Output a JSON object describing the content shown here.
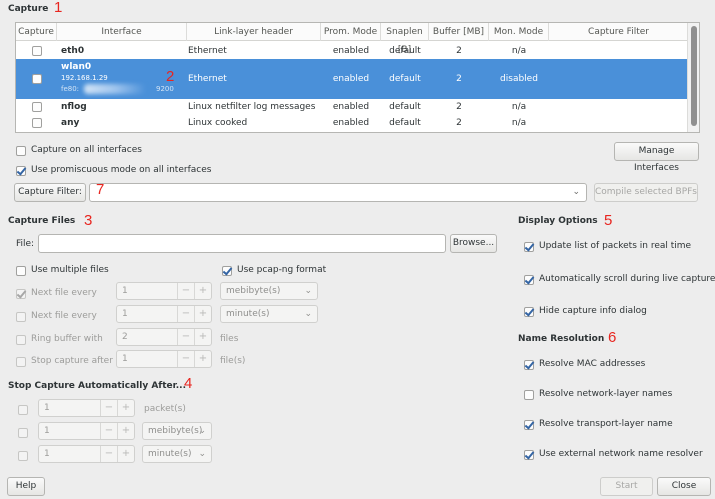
{
  "capture": {
    "title": "Capture",
    "columns": [
      "Capture",
      "Interface",
      "Link-layer header",
      "Prom. Mode",
      "Snaplen [B]",
      "Buffer [MB]",
      "Mon. Mode",
      "Capture Filter"
    ],
    "rows": [
      {
        "name": "eth0",
        "addr1": "",
        "addr2": "",
        "link": "Ethernet",
        "prom": "enabled",
        "snap": "default",
        "buffer": "2",
        "mon": "n/a",
        "checked": false,
        "selected": false
      },
      {
        "name": "wlan0",
        "addr1": "192.168.1.29",
        "addr2": "fe80:",
        "addr3": "9200",
        "link": "Ethernet",
        "prom": "enabled",
        "snap": "default",
        "buffer": "2",
        "mon": "disabled",
        "checked": false,
        "selected": true
      },
      {
        "name": "nflog",
        "addr1": "",
        "addr2": "",
        "link": "Linux netfilter log messages",
        "prom": "enabled",
        "snap": "default",
        "buffer": "2",
        "mon": "n/a",
        "checked": false,
        "selected": false
      },
      {
        "name": "any",
        "addr1": "",
        "addr2": "",
        "link": "Linux cooked",
        "prom": "enabled",
        "snap": "default",
        "buffer": "2",
        "mon": "n/a",
        "checked": false,
        "selected": false
      }
    ],
    "capture_all_label": "Capture on all interfaces",
    "promiscuous_label": "Use promiscuous mode on all interfaces",
    "manage_interfaces_label": "Manage Interfaces",
    "capture_filter_label": "Capture Filter:",
    "capture_filter_value": "",
    "compile_bpfs_label": "Compile selected BPFs"
  },
  "capture_files": {
    "title": "Capture Files",
    "file_label": "File:",
    "file_value": "",
    "browse_label": "Browse...",
    "multiple_files_label": "Use multiple files",
    "pcapng_label": "Use pcap-ng format",
    "next_file_every_1": {
      "label": "Next file every",
      "value": "1",
      "unit": "mebibyte(s)"
    },
    "next_file_every_2": {
      "label": "Next file every",
      "value": "1",
      "unit": "minute(s)"
    },
    "ring_buffer": {
      "label": "Ring buffer with",
      "value": "2",
      "unit": "files"
    },
    "stop_capture_after": {
      "label": "Stop capture after",
      "value": "1",
      "unit": "file(s)"
    }
  },
  "stop_capture": {
    "title": "Stop Capture Automatically After...",
    "packets": {
      "value": "1",
      "unit": "packet(s)"
    },
    "size": {
      "value": "1",
      "unit": "mebibyte(s)"
    },
    "time": {
      "value": "1",
      "unit": "minute(s)"
    }
  },
  "display_options": {
    "title": "Display Options",
    "update_list_label": "Update list of packets in real time",
    "auto_scroll_label": "Automatically scroll during live capture",
    "hide_info_label": "Hide capture info dialog"
  },
  "name_resolution": {
    "title": "Name Resolution",
    "mac_label": "Resolve MAC addresses",
    "network_label": "Resolve network-layer names",
    "transport_label": "Resolve transport-layer name",
    "external_label": "Use external network name resolver"
  },
  "footer": {
    "help_label": "Help",
    "start_label": "Start",
    "close_label": "Close"
  },
  "annotations": {
    "n1": "1",
    "n2": "2",
    "n3": "3",
    "n4": "4",
    "n5": "5",
    "n6": "6",
    "n7": "7"
  },
  "colors": {
    "selection": "#4a90d9",
    "check": "#3465a4",
    "annotation": "#e8251f"
  }
}
